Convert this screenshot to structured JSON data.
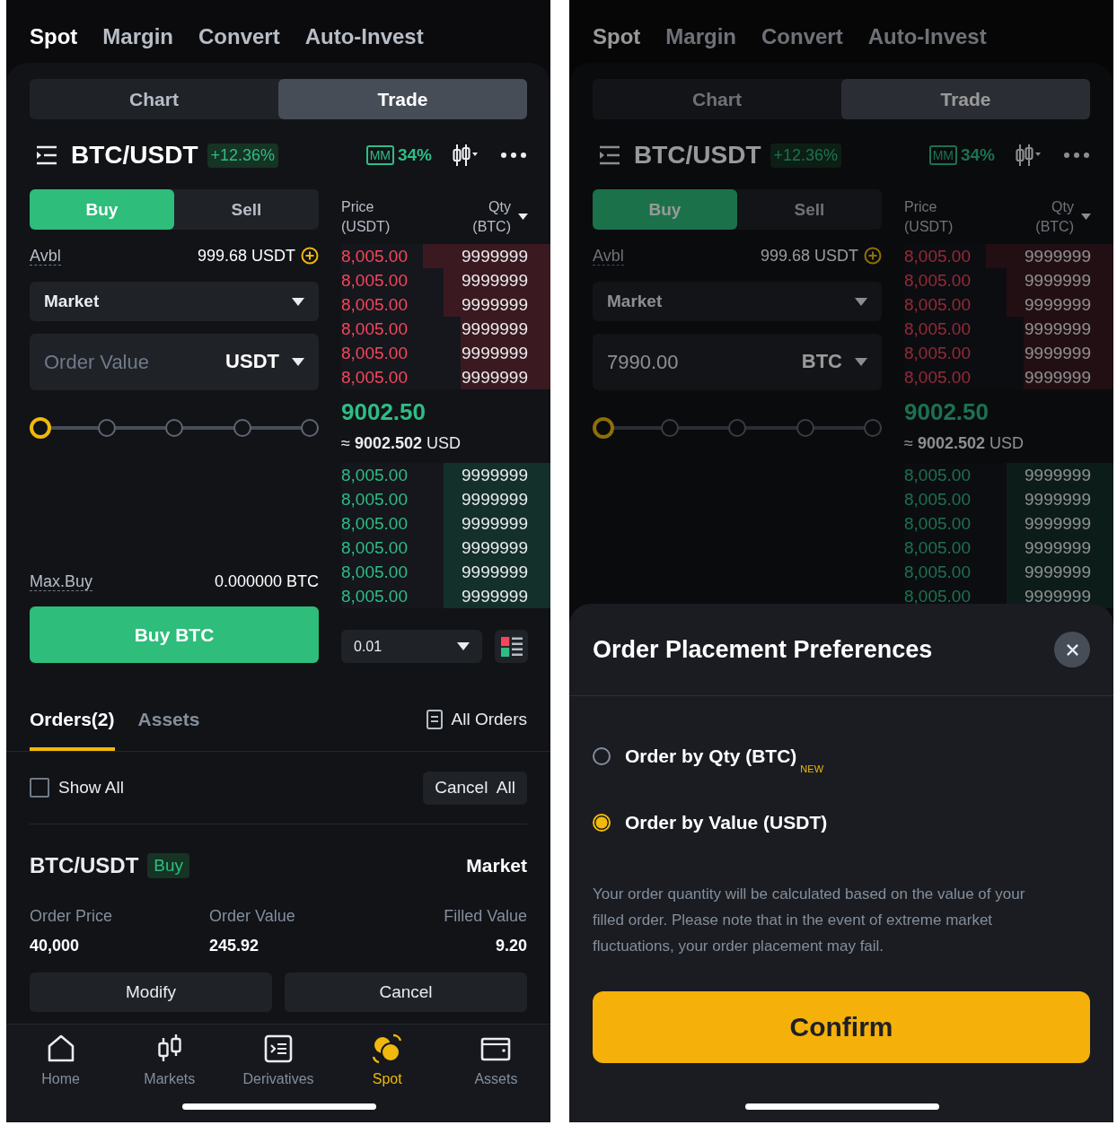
{
  "screens": [
    {
      "top_tabs": [
        {
          "label": "Spot",
          "selected": true
        },
        {
          "label": "Margin",
          "selected": false
        },
        {
          "label": "Convert",
          "selected": false
        },
        {
          "label": "Auto-Invest",
          "selected": false
        }
      ],
      "view_tabs": [
        {
          "label": "Chart",
          "selected": false
        },
        {
          "label": "Trade",
          "selected": true
        }
      ],
      "pair": {
        "name": "BTC/USDT",
        "change": "+12.36%",
        "mm_badge": "MM",
        "mm_value": "34%"
      },
      "side_tabs": [
        {
          "label": "Buy",
          "selected": true
        },
        {
          "label": "Sell",
          "selected": false
        }
      ],
      "available": {
        "label": "Avbl",
        "value": "999.68 USDT"
      },
      "order_type": "Market",
      "order_field": {
        "placeholder": "Order Value",
        "unit": "USDT"
      },
      "slider": {
        "level": 0
      },
      "max_buy": {
        "label": "Max.Buy",
        "value": "0.000000 BTC"
      },
      "buy_button": "Buy BTC",
      "order_book": {
        "price_header": "Price",
        "price_unit": "(USDT)",
        "qty_header": "Qty",
        "qty_unit": "(BTC)",
        "asks": [
          {
            "price": "8,005.00",
            "qty": "9999999",
            "level": 0.61
          },
          {
            "price": "8,005.00",
            "qty": "9999999",
            "level": 0.51
          },
          {
            "price": "8,005.00",
            "qty": "9999999",
            "level": 0.51
          },
          {
            "price": "8,005.00",
            "qty": "9999999",
            "level": 0.43
          },
          {
            "price": "8,005.00",
            "qty": "9999999",
            "level": 0.43
          },
          {
            "price": "8,005.00",
            "qty": "9999999",
            "level": 0.43
          }
        ],
        "last_price": "9002.50",
        "approx": "≈ **9002.502** USD",
        "bids": [
          {
            "price": "8,005.00",
            "qty": "9999999",
            "level": 0.51
          },
          {
            "price": "8,005.00",
            "qty": "9999999",
            "level": 0.51
          },
          {
            "price": "8,005.00",
            "qty": "9999999",
            "level": 0.51
          },
          {
            "price": "8,005.00",
            "qty": "9999999",
            "level": 0.51
          },
          {
            "price": "8,005.00",
            "qty": "9999999",
            "level": 0.51
          },
          {
            "price": "8,005.00",
            "qty": "9999999",
            "level": 0.51
          }
        ],
        "depth": "0.01"
      },
      "orders": {
        "tabs": [
          {
            "label": "Orders(2)",
            "selected": true
          },
          {
            "label": "Assets",
            "selected": false
          }
        ],
        "all_orders": "All Orders",
        "show_all": {
          "label": "Show All",
          "checked": false
        },
        "cancel_all": "Cancel  All",
        "order": {
          "pair": "BTC/USDT",
          "side": "Buy",
          "type": "Market",
          "fields": [
            {
              "label": "Order Price",
              "value": "40,000"
            },
            {
              "label": "Order Value",
              "value": "245.92"
            },
            {
              "label": "Filled Value",
              "value": "9.20"
            }
          ],
          "actions": [
            "Modify",
            "Cancel"
          ]
        }
      },
      "nav": [
        {
          "label": "Home",
          "kind": "home",
          "selected": false
        },
        {
          "label": "Markets",
          "kind": "markets",
          "selected": false
        },
        {
          "label": "Derivatives",
          "kind": "derivatives",
          "selected": false
        },
        {
          "label": "Spot",
          "kind": "spot",
          "selected": true
        },
        {
          "label": "Assets",
          "kind": "assets",
          "selected": false
        }
      ]
    },
    {
      "top_tabs": [
        {
          "label": "Spot",
          "selected": true
        },
        {
          "label": "Margin",
          "selected": false
        },
        {
          "label": "Convert",
          "selected": false
        },
        {
          "label": "Auto-Invest",
          "selected": false
        }
      ],
      "view_tabs": [
        {
          "label": "Chart",
          "selected": false
        },
        {
          "label": "Trade",
          "selected": true
        }
      ],
      "pair": {
        "name": "BTC/USDT",
        "change": "+12.36%",
        "mm_badge": "MM",
        "mm_value": "34%"
      },
      "side_tabs": [
        {
          "label": "Buy",
          "selected": true
        },
        {
          "label": "Sell",
          "selected": false
        }
      ],
      "available": {
        "label": "Avbl",
        "value": "999.68 USDT"
      },
      "order_type": "Market",
      "order_field": {
        "value": "7990.00",
        "unit": "BTC"
      },
      "slider": {
        "level": 0
      },
      "order_book": {
        "price_header": "Price",
        "price_unit": "(USDT)",
        "qty_header": "Qty",
        "qty_unit": "(BTC)",
        "asks": [
          {
            "price": "8,005.00",
            "qty": "9999999",
            "level": 0.61
          },
          {
            "price": "8,005.00",
            "qty": "9999999",
            "level": 0.51
          },
          {
            "price": "8,005.00",
            "qty": "9999999",
            "level": 0.51
          },
          {
            "price": "8,005.00",
            "qty": "9999999",
            "level": 0.43
          },
          {
            "price": "8,005.00",
            "qty": "9999999",
            "level": 0.43
          },
          {
            "price": "8,005.00",
            "qty": "9999999",
            "level": 0.43
          }
        ],
        "last_price": "9002.50",
        "approx": "≈ **9002.502** USD",
        "bids": [
          {
            "price": "8,005.00",
            "qty": "9999999",
            "level": 0.51
          },
          {
            "price": "8,005.00",
            "qty": "9999999",
            "level": 0.51
          },
          {
            "price": "8,005.00",
            "qty": "9999999",
            "level": 0.51
          },
          {
            "price": "8,005.00",
            "qty": "9999999",
            "level": 0.51
          },
          {
            "price": "8,005.00",
            "qty": "9999999",
            "level": 0.51
          },
          {
            "price": "8,005.00",
            "qty": "9999999",
            "level": 0.51
          }
        ]
      },
      "sheet": {
        "title": "Order Placement Preferences",
        "options": [
          {
            "label": "Order by Qty (BTC)",
            "badge": "NEW",
            "selected": false
          },
          {
            "label": "Order by Value (USDT)",
            "selected": true
          }
        ],
        "note": "Your order quantity will be calculated based on the value of your filled order. Please note that in the event of extreme market fluctuations, your order placement may fail.",
        "confirm": "Confirm"
      }
    }
  ]
}
